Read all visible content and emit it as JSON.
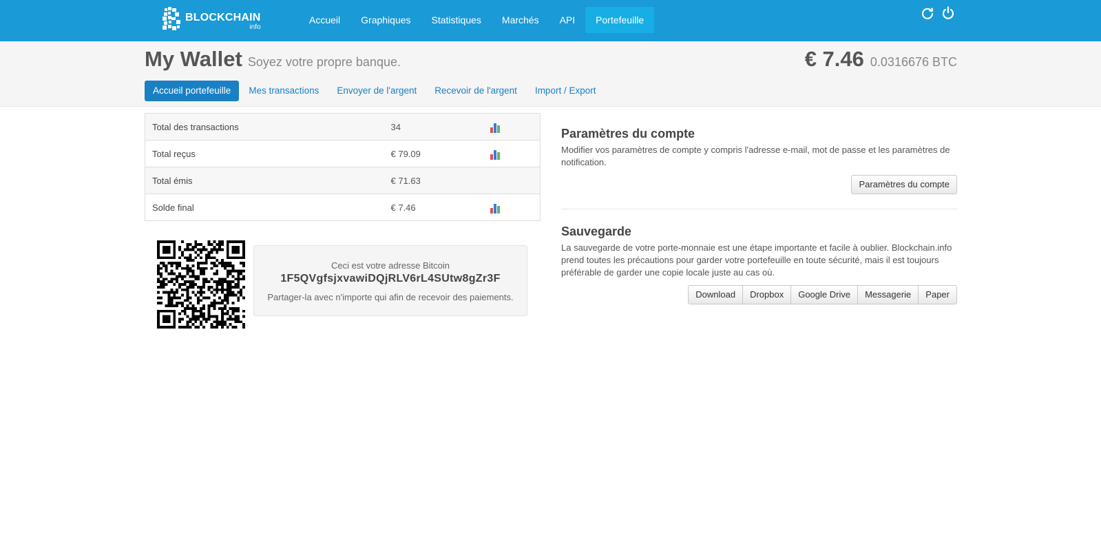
{
  "brand": {
    "name": "BLOCKCHAIN",
    "sub": "info"
  },
  "nav": {
    "items": [
      {
        "label": "Accueil",
        "active": false
      },
      {
        "label": "Graphiques",
        "active": false
      },
      {
        "label": "Statistiques",
        "active": false
      },
      {
        "label": "Marchés",
        "active": false
      },
      {
        "label": "API",
        "active": false
      },
      {
        "label": "Portefeuille",
        "active": true
      }
    ],
    "icons": [
      "refresh-icon",
      "power-icon"
    ]
  },
  "header": {
    "title": "My Wallet",
    "tagline": "Soyez votre propre banque.",
    "balance_fiat": "€ 7.46",
    "balance_btc": "0.0316676 BTC"
  },
  "subtabs": [
    {
      "label": "Accueil portefeuille",
      "active": true
    },
    {
      "label": "Mes transactions",
      "active": false
    },
    {
      "label": "Envoyer de l'argent",
      "active": false
    },
    {
      "label": "Recevoir de l'argent",
      "active": false
    },
    {
      "label": "Import / Export",
      "active": false
    }
  ],
  "stats": [
    {
      "label": "Total des transactions",
      "value": "34",
      "chart": true
    },
    {
      "label": "Total reçus",
      "value": "€ 79.09",
      "chart": true
    },
    {
      "label": "Total émis",
      "value": "€ 71.63",
      "chart": false
    },
    {
      "label": "Solde final",
      "value": "€ 7.46",
      "chart": true
    }
  ],
  "address_box": {
    "intro": "Ceci est votre adresse Bitcoin",
    "address": "1F5QVgfsjxvawiDQjRLV6rL4SUtw8gZr3F",
    "share": "Partager-la avec n'importe qui afin de recevoir des paiements."
  },
  "account": {
    "title": "Paramètres du compte",
    "description": "Modifier vos paramètres de compte y compris l'adresse e-mail, mot de passe et les paramètres de notification.",
    "button": "Paramètres du compte"
  },
  "backup": {
    "title": "Sauvegarde",
    "description": "La sauvegarde de votre porte-monnaie est une étape importante et facile à oublier. Blockchain.info prend toutes les précautions pour garder votre portefeuille en toute sécurité, mais il est toujours préférable de garder une copie locale juste au cas où.",
    "buttons": [
      "Download",
      "Dropbox",
      "Google Drive",
      "Messagerie",
      "Paper"
    ]
  },
  "colors": {
    "topbar": "#1a9ad6",
    "nav_active": "#16aee4",
    "tab_active": "#1a80c4"
  }
}
